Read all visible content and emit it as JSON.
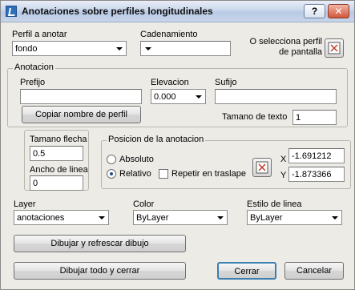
{
  "window": {
    "title": "Anotaciones sobre perfiles longitudinales",
    "help_label": "?",
    "close_label": "✕"
  },
  "perfil": {
    "label": "Perfil a anotar",
    "value": "fondo"
  },
  "cadenamiento": {
    "label": "Cadenamiento",
    "value": ""
  },
  "select_perfil": {
    "label": "O selecciona perfil de pantalla"
  },
  "anotacion": {
    "group_label": "Anotacion",
    "prefijo_label": "Prefijo",
    "prefijo_value": "",
    "elevacion_label": "Elevacion",
    "elevacion_value": "0.000",
    "sufijo_label": "Sufijo",
    "sufijo_value": "",
    "copy_button": "Copiar nombre de perfil",
    "text_size_label": "Tamano de texto",
    "text_size_value": "1"
  },
  "flecha": {
    "size_label": "Tamano flecha",
    "size_value": "0.5",
    "width_label": "Ancho de linea",
    "width_value": "0"
  },
  "posicion": {
    "group_label": "Posicion de la anotacion",
    "absoluto_label": "Absoluto",
    "relativo_label": "Relativo",
    "repetir_label": "Repetir en traslape",
    "x_label": "X",
    "x_value": "-1.691212",
    "y_label": "Y",
    "y_value": "-1.873366"
  },
  "layer": {
    "label": "Layer",
    "value": "anotaciones"
  },
  "color": {
    "label": "Color",
    "value": "ByLayer"
  },
  "estilo": {
    "label": "Estilo de linea",
    "value": "ByLayer"
  },
  "buttons": {
    "refresh": "Dibujar y refrescar dibujo",
    "draw_all": "Dibujar todo y cerrar",
    "close": "Cerrar",
    "cancel": "Cancelar"
  }
}
